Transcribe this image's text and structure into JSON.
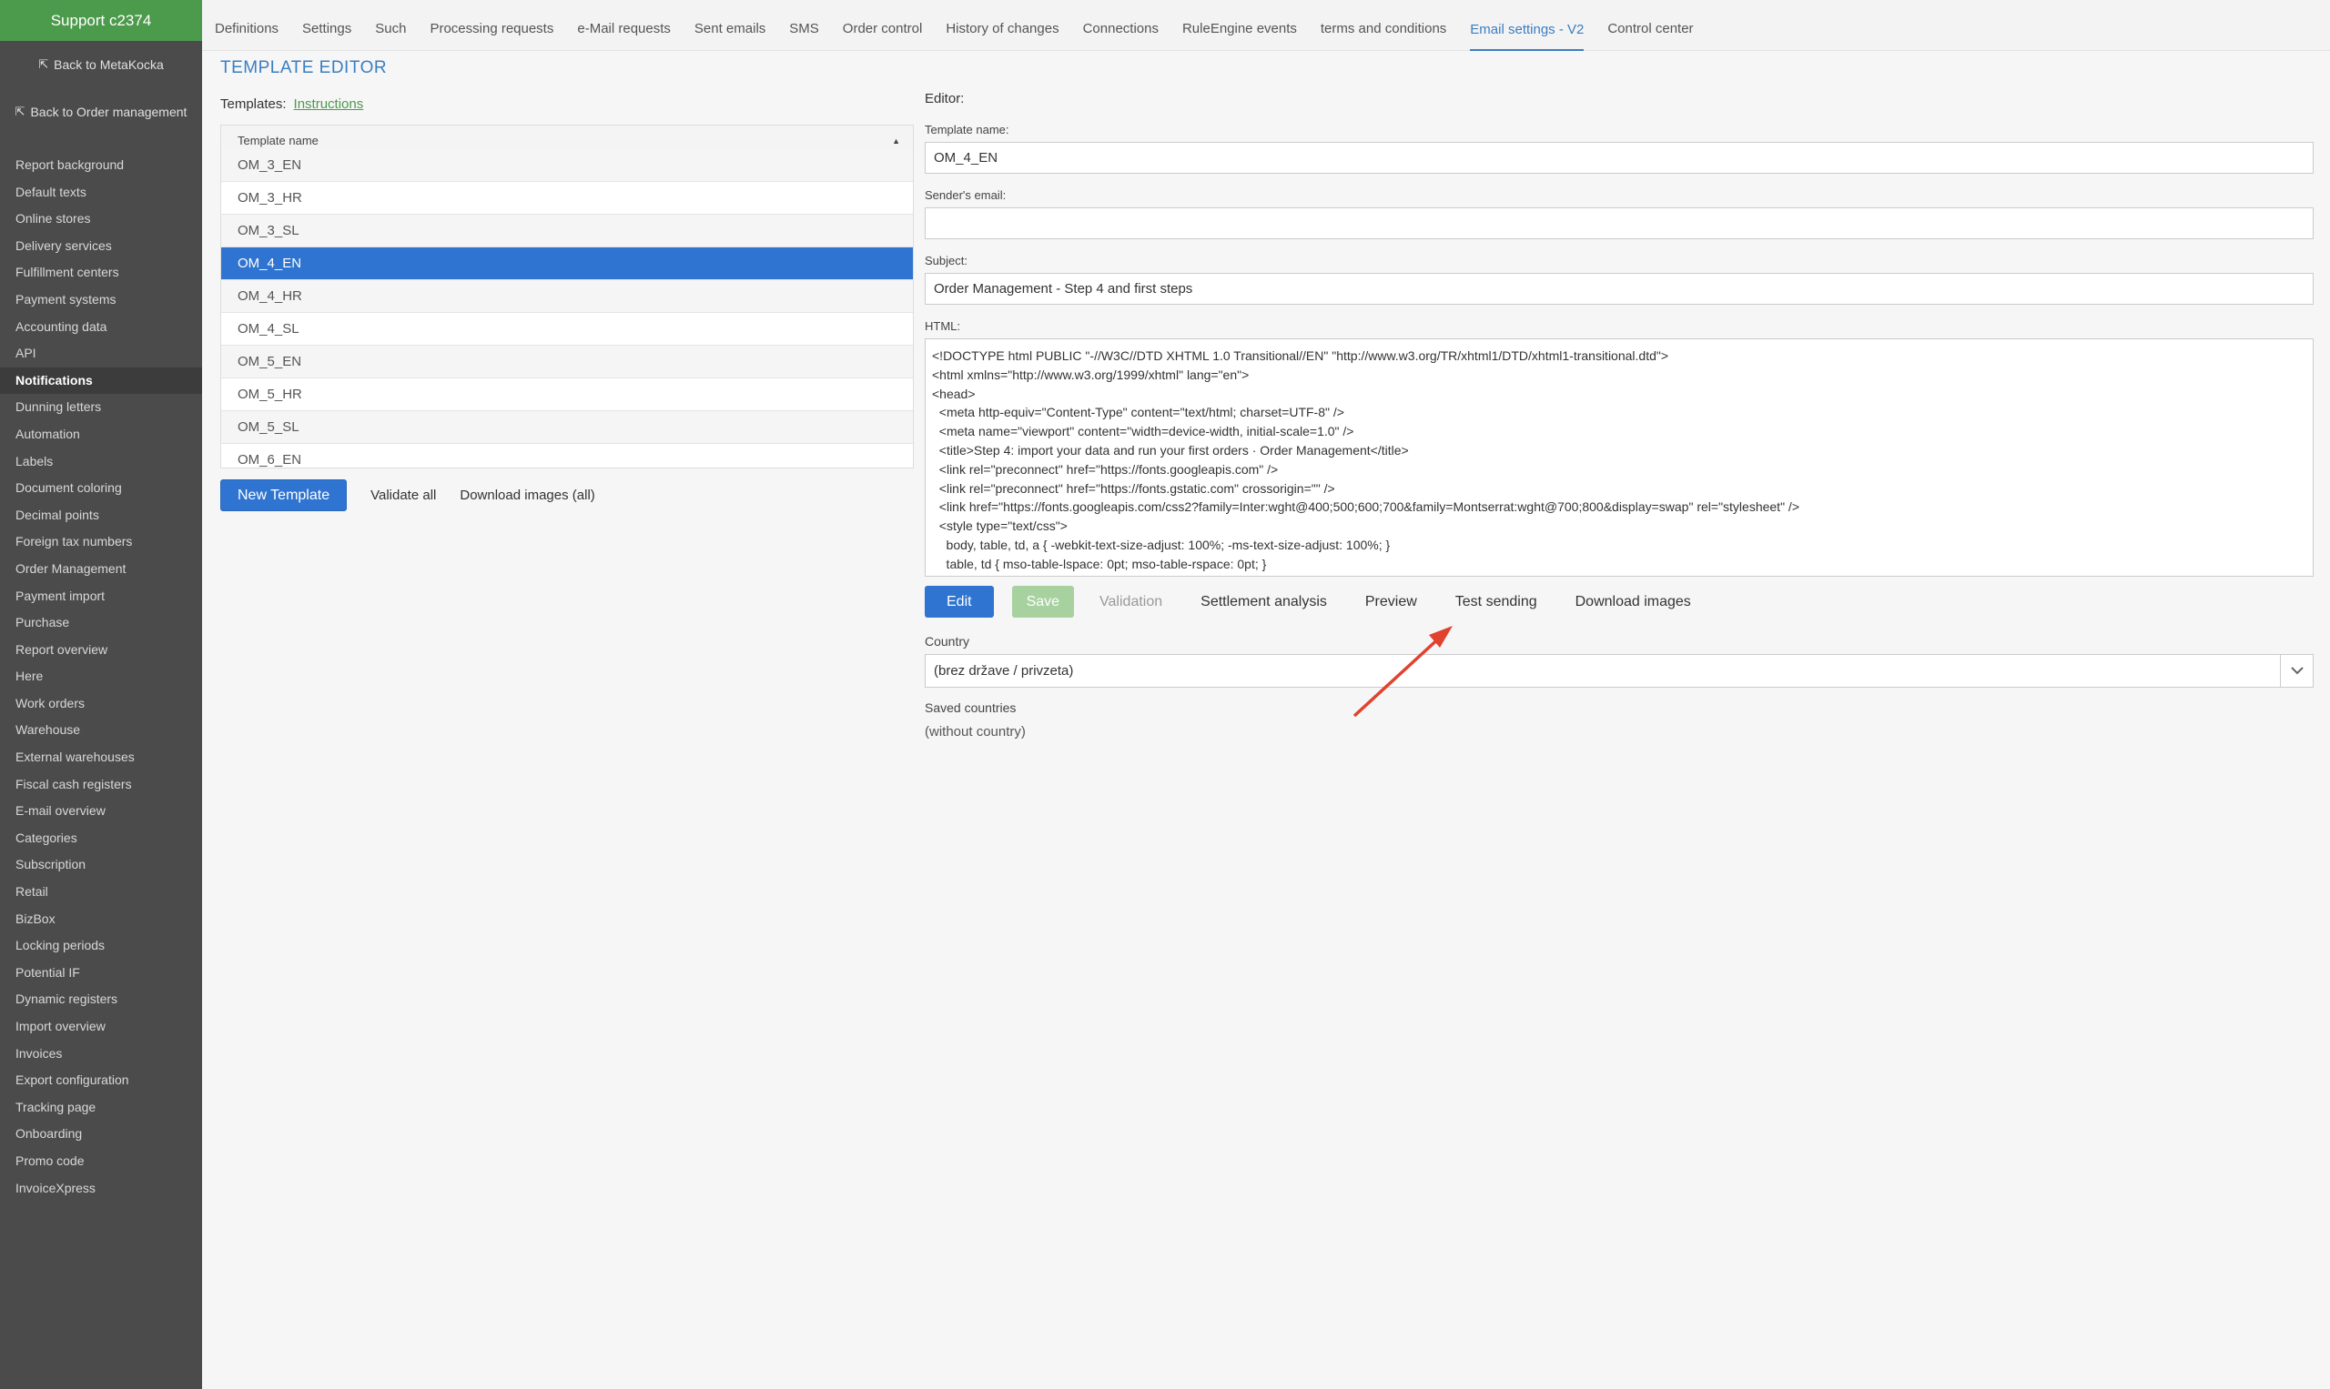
{
  "sidebar": {
    "brand": "Support c2374",
    "back_links": [
      {
        "label": "Back to MetaKocka"
      },
      {
        "label": "Back to Order management"
      }
    ],
    "items": [
      {
        "label": "Report background"
      },
      {
        "label": "Default texts"
      },
      {
        "label": "Online stores"
      },
      {
        "label": "Delivery services"
      },
      {
        "label": "Fulfillment centers"
      },
      {
        "label": "Payment systems"
      },
      {
        "label": "Accounting data"
      },
      {
        "label": "API"
      },
      {
        "label": "Notifications",
        "active": true
      },
      {
        "label": "Dunning letters"
      },
      {
        "label": "Automation"
      },
      {
        "label": "Labels"
      },
      {
        "label": "Document coloring"
      },
      {
        "label": "Decimal points"
      },
      {
        "label": "Foreign tax numbers"
      },
      {
        "label": "Order Management"
      },
      {
        "label": "Payment import"
      },
      {
        "label": "Purchase"
      },
      {
        "label": "Report overview"
      },
      {
        "label": "Here"
      },
      {
        "label": "Work orders"
      },
      {
        "label": "Warehouse"
      },
      {
        "label": "External warehouses"
      },
      {
        "label": "Fiscal cash registers"
      },
      {
        "label": "E-mail overview"
      },
      {
        "label": "Categories"
      },
      {
        "label": "Subscription"
      },
      {
        "label": "Retail"
      },
      {
        "label": "BizBox"
      },
      {
        "label": "Locking periods"
      },
      {
        "label": "Potential IF"
      },
      {
        "label": "Dynamic registers"
      },
      {
        "label": "Import overview"
      },
      {
        "label": "Invoices"
      },
      {
        "label": "Export configuration"
      },
      {
        "label": "Tracking page"
      },
      {
        "label": "Onboarding"
      },
      {
        "label": "Promo code"
      },
      {
        "label": "InvoiceXpress"
      }
    ]
  },
  "topnav": {
    "tabs": [
      {
        "label": "Definitions"
      },
      {
        "label": "Settings"
      },
      {
        "label": "Such"
      },
      {
        "label": "Processing requests"
      },
      {
        "label": "e-Mail requests"
      },
      {
        "label": "Sent emails"
      },
      {
        "label": "SMS"
      },
      {
        "label": "Order control"
      },
      {
        "label": "History of changes"
      },
      {
        "label": "Connections"
      },
      {
        "label": "RuleEngine events"
      },
      {
        "label": "terms and conditions"
      },
      {
        "label": "Email settings - V2",
        "active": true
      },
      {
        "label": "Control center"
      }
    ]
  },
  "main": {
    "title": "TEMPLATE EDITOR",
    "templates_label": "Templates:",
    "instructions_link": "Instructions",
    "table": {
      "header": "Template name",
      "rows": [
        {
          "name": "OM_3_EN"
        },
        {
          "name": "OM_3_HR"
        },
        {
          "name": "OM_3_SL"
        },
        {
          "name": "OM_4_EN",
          "selected": true
        },
        {
          "name": "OM_4_HR"
        },
        {
          "name": "OM_4_SL"
        },
        {
          "name": "OM_5_EN"
        },
        {
          "name": "OM_5_HR"
        },
        {
          "name": "OM_5_SL"
        },
        {
          "name": "OM_6_EN"
        }
      ]
    },
    "actions": {
      "new_template": "New Template",
      "validate_all": "Validate all",
      "download_images_all": "Download images (all)"
    }
  },
  "editor": {
    "label": "Editor:",
    "template_name_label": "Template name:",
    "template_name_value": "OM_4_EN",
    "sender_email_label": "Sender's email:",
    "sender_email_value": "",
    "subject_label": "Subject:",
    "subject_value": "Order Management - Step 4 and first steps",
    "html_label": "HTML:",
    "html_value": "<!DOCTYPE html PUBLIC \"-//W3C//DTD XHTML 1.0 Transitional//EN\" \"http://www.w3.org/TR/xhtml1/DTD/xhtml1-transitional.dtd\">\n<html xmlns=\"http://www.w3.org/1999/xhtml\" lang=\"en\">\n<head>\n  <meta http-equiv=\"Content-Type\" content=\"text/html; charset=UTF-8\" />\n  <meta name=\"viewport\" content=\"width=device-width, initial-scale=1.0\" />\n  <title>Step 4: import your data and run your first orders · Order Management</title>\n  <link rel=\"preconnect\" href=\"https://fonts.googleapis.com\" />\n  <link rel=\"preconnect\" href=\"https://fonts.gstatic.com\" crossorigin=\"\" />\n  <link href=\"https://fonts.googleapis.com/css2?family=Inter:wght@400;500;600;700&family=Montserrat:wght@700;800&display=swap\" rel=\"stylesheet\" />\n  <style type=\"text/css\">\n    body, table, td, a { -webkit-text-size-adjust: 100%; -ms-text-size-adjust: 100%; }\n    table, td { mso-table-lspace: 0pt; mso-table-rspace: 0pt; }",
    "buttons": {
      "edit": "Edit",
      "save": "Save",
      "validation": "Validation",
      "settlement_analysis": "Settlement analysis",
      "preview": "Preview",
      "test_sending": "Test sending",
      "download_images": "Download images"
    },
    "country_label": "Country",
    "country_value": "(brez države / privzeta)",
    "saved_countries_label": "Saved countries",
    "saved_countries_value": "(without country)"
  },
  "colors": {
    "brand_green": "#4c9a4c",
    "sidebar_bg": "#4b4b4b",
    "accent_blue": "#2f74d0",
    "save_green": "#a8d1a0",
    "annotation_red": "#e0422e"
  }
}
